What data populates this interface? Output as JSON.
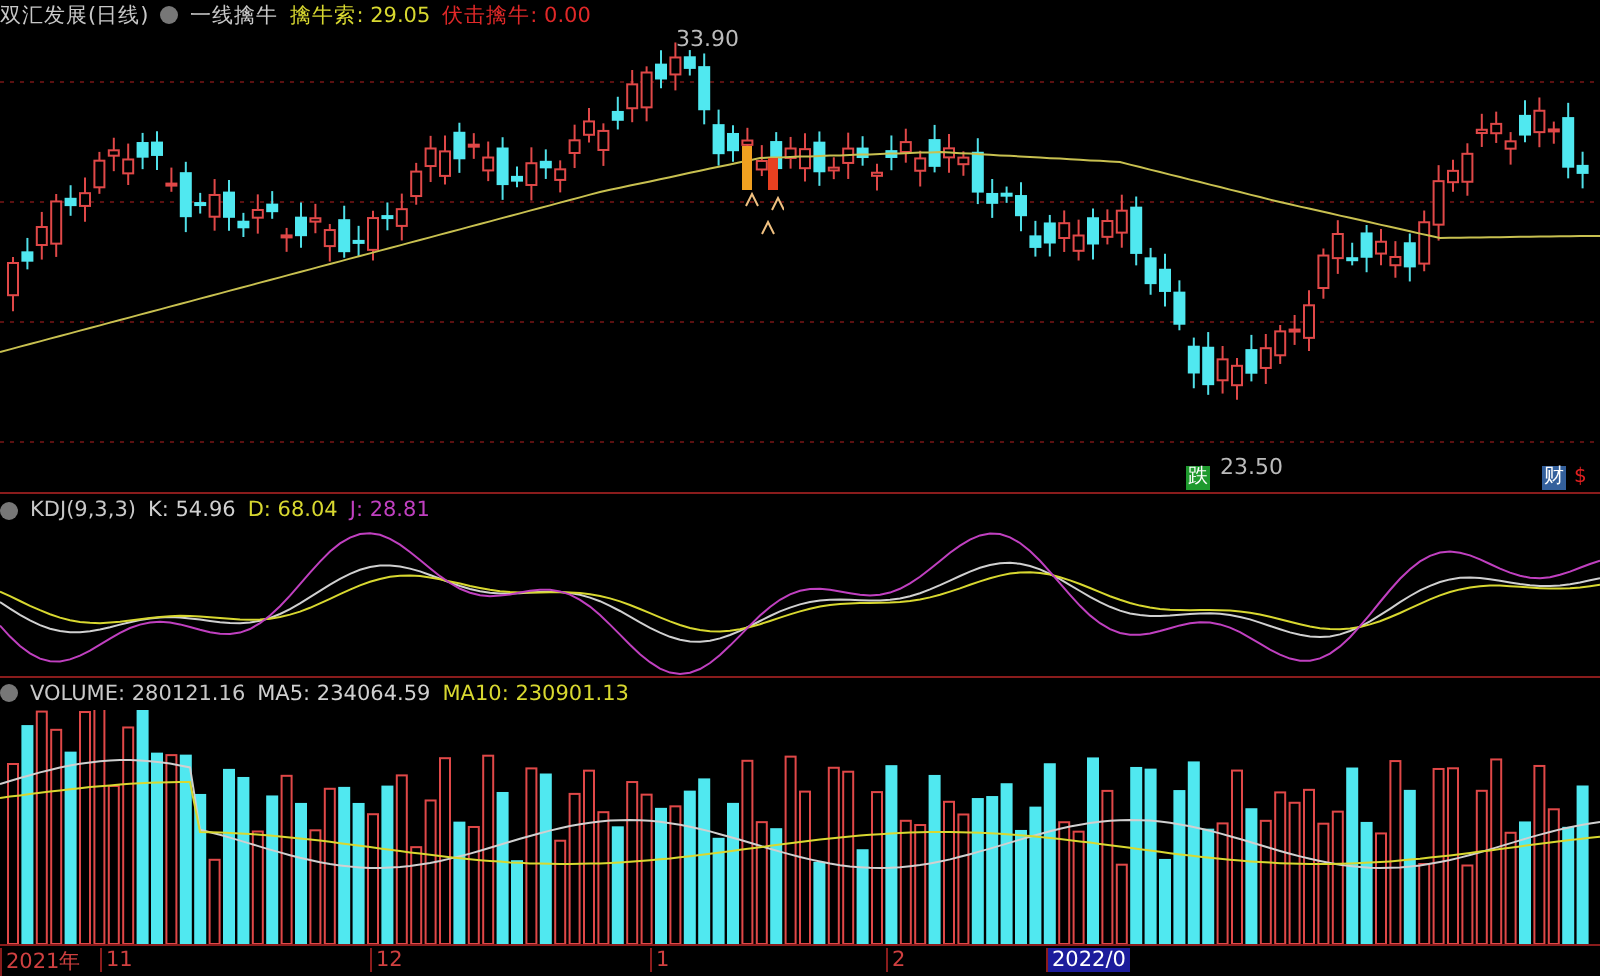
{
  "title": "双汇发展(日线)",
  "indicator": {
    "name": "一线擒牛",
    "values": [
      {
        "label": "擒牛索: 29.05",
        "color": "#d8d830"
      },
      {
        "label": "伏击擒牛: 0.00",
        "color": "#e02828"
      }
    ]
  },
  "price_marks": [
    {
      "text": "33.90"
    },
    {
      "text": "23.50"
    }
  ],
  "badges": [
    {
      "text": "跌",
      "color": "#1e9a2e"
    },
    {
      "text": "财",
      "color": "#34609c"
    },
    {
      "text": "$",
      "color": "#e02020"
    }
  ],
  "kdj": {
    "name": "KDJ(9,3,3)",
    "values": [
      {
        "label": "K: 54.96",
        "color": "#d0d0d0"
      },
      {
        "label": "D: 68.04",
        "color": "#d8d830"
      },
      {
        "label": "J: 28.81",
        "color": "#c040c0"
      }
    ]
  },
  "volume": {
    "name": "VOLUME: 280121.16",
    "values": [
      {
        "label": "MA5: 234064.59",
        "color": "#d0d0d0"
      },
      {
        "label": "MA10: 230901.13",
        "color": "#d8d830"
      }
    ]
  },
  "axis": [
    {
      "label": "2021年",
      "selected": false
    },
    {
      "label": "11",
      "selected": false
    },
    {
      "label": "12",
      "selected": false
    },
    {
      "label": "1",
      "selected": false
    },
    {
      "label": "2",
      "selected": false
    },
    {
      "label": "2022/0",
      "selected": true
    }
  ]
}
